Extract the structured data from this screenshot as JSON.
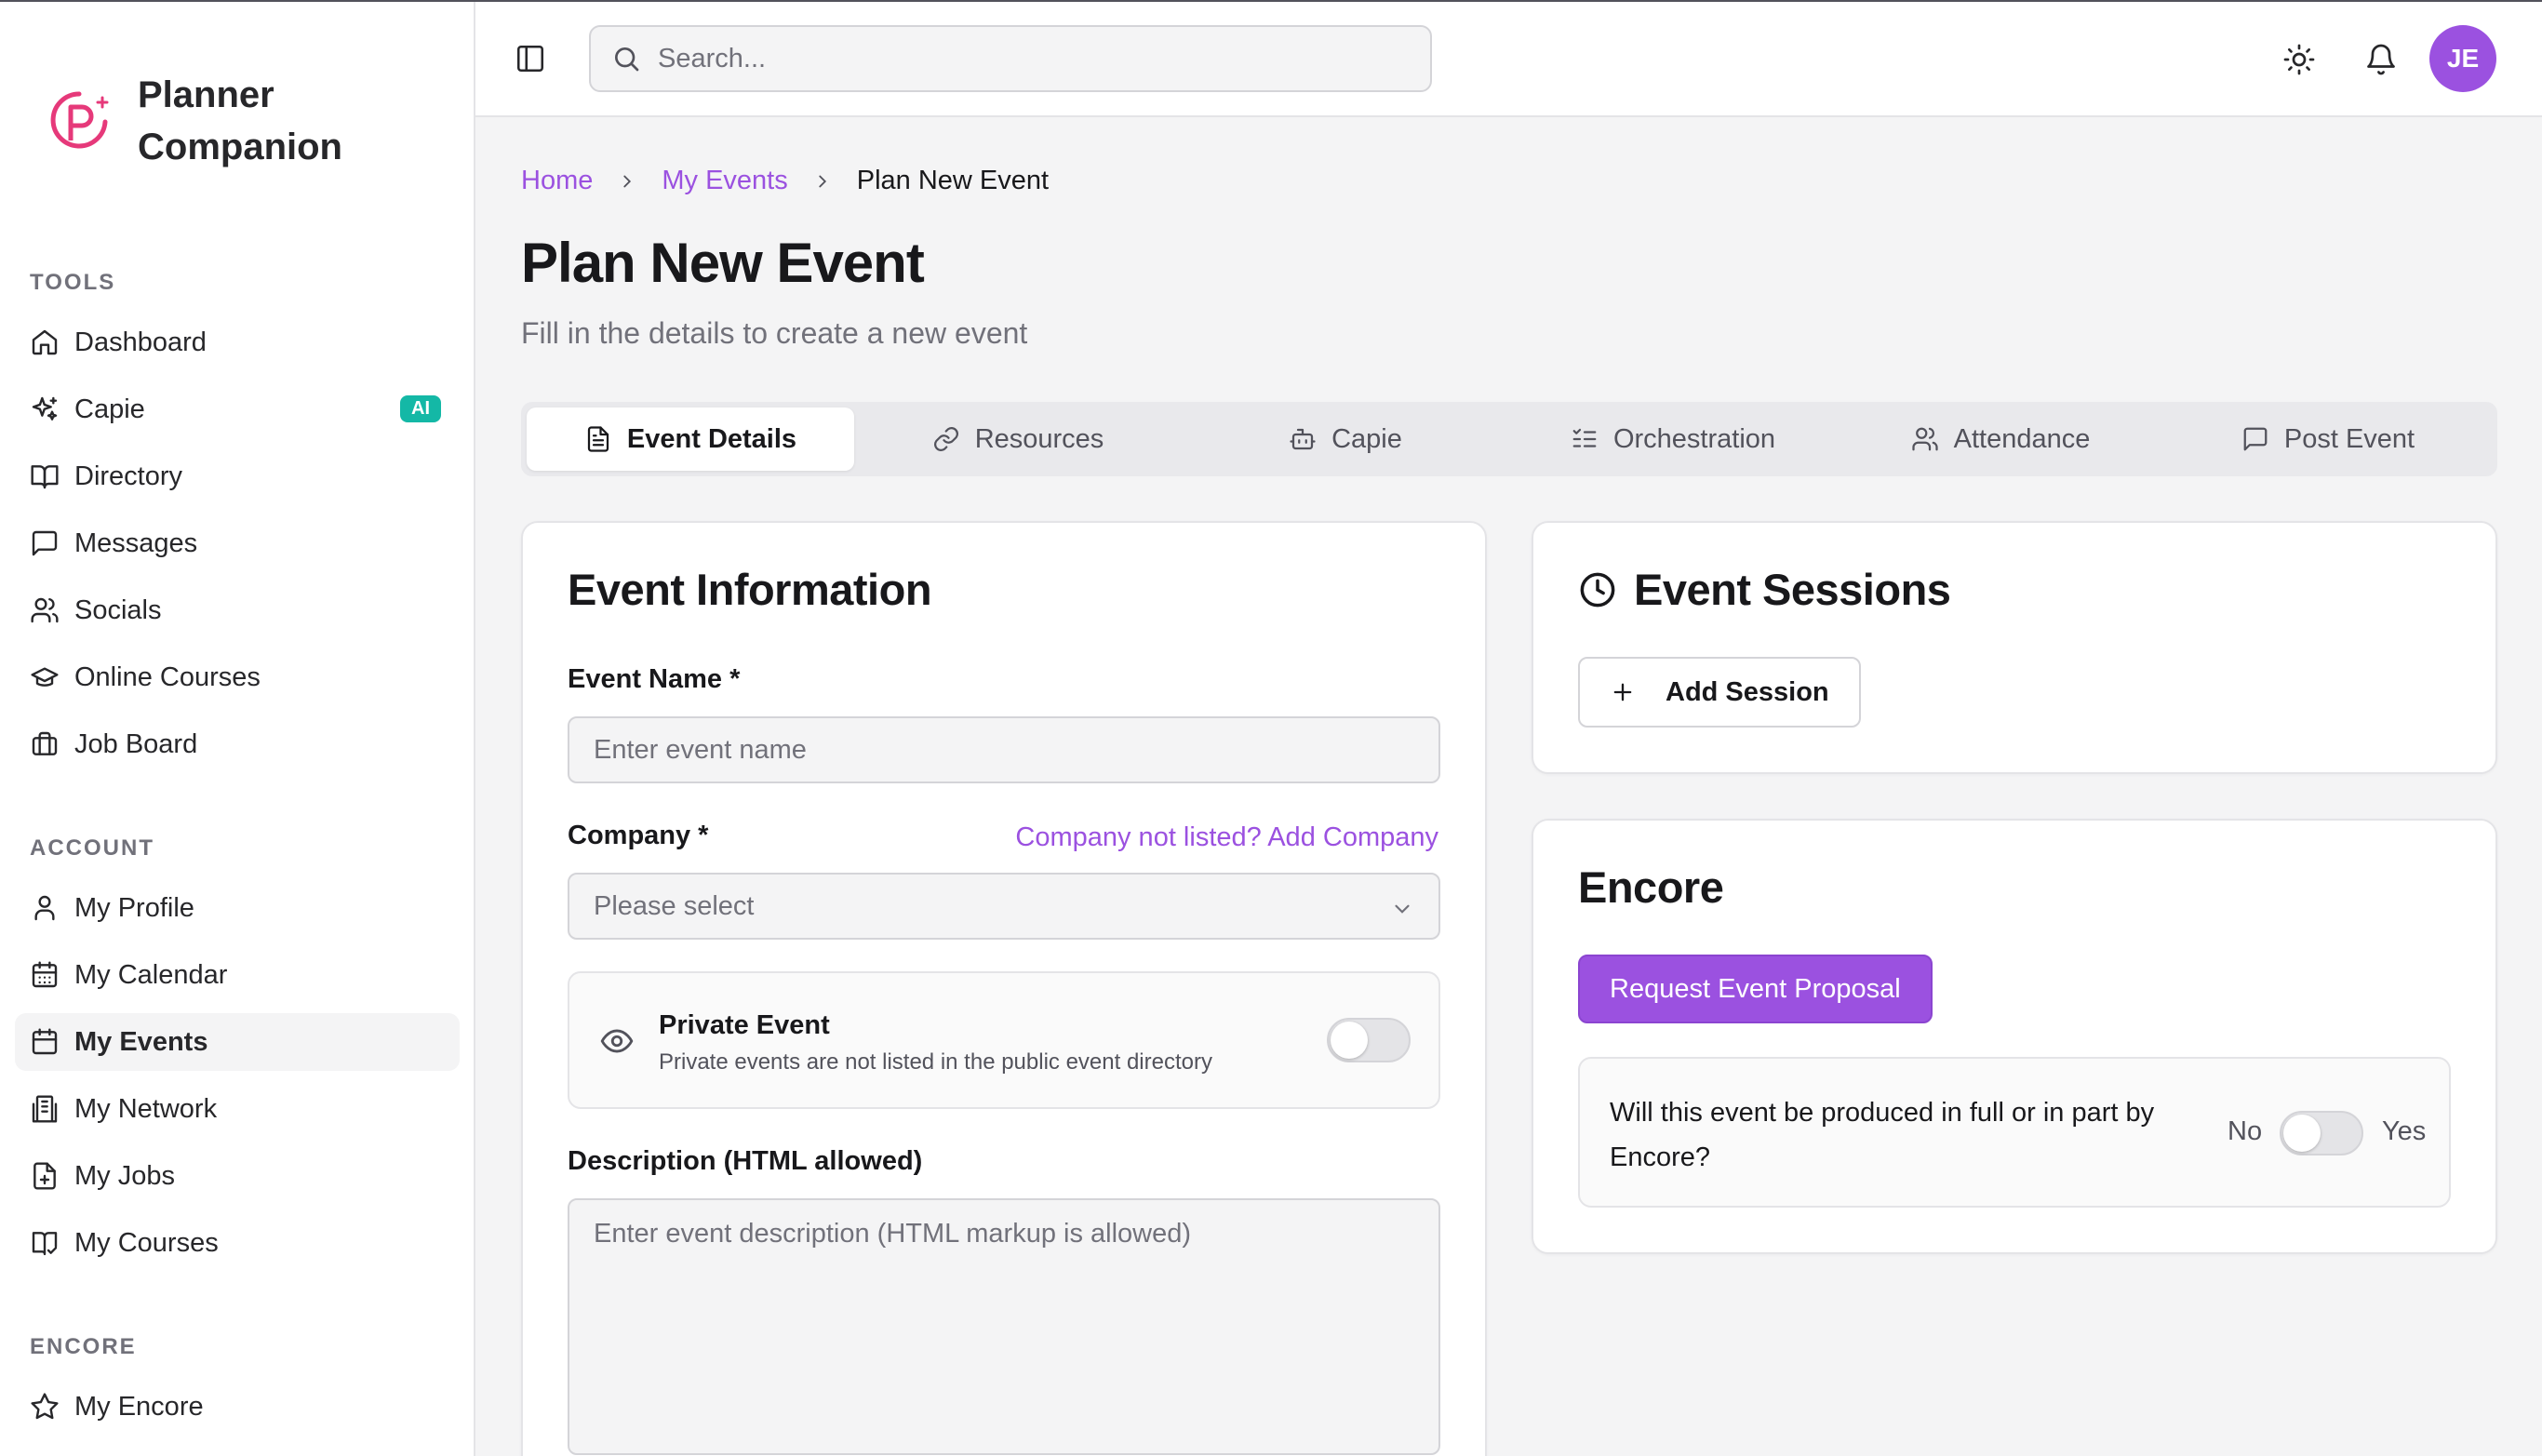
{
  "app": {
    "name": "Planner Companion",
    "brand_color": "#e6397a",
    "accent_color": "#9b51e0"
  },
  "sidebar": {
    "sections": {
      "tools": "TOOLS",
      "account": "ACCOUNT",
      "encore": "ENCORE"
    },
    "items": [
      {
        "label": "Dashboard",
        "icon": "home-icon"
      },
      {
        "label": "Capie",
        "icon": "sparkles-icon",
        "badge": "AI"
      },
      {
        "label": "Directory",
        "icon": "book-open-icon"
      },
      {
        "label": "Messages",
        "icon": "message-square-icon"
      },
      {
        "label": "Socials",
        "icon": "users-icon"
      },
      {
        "label": "Online Courses",
        "icon": "graduation-cap-icon"
      },
      {
        "label": "Job Board",
        "icon": "briefcase-icon"
      },
      {
        "label": "My Profile",
        "icon": "user-icon"
      },
      {
        "label": "My Calendar",
        "icon": "calendar-days-icon"
      },
      {
        "label": "My Events",
        "icon": "calendar-icon",
        "active": true
      },
      {
        "label": "My Network",
        "icon": "network-icon"
      },
      {
        "label": "My Jobs",
        "icon": "file-plus-icon"
      },
      {
        "label": "My Courses",
        "icon": "book-check-icon"
      },
      {
        "label": "My Encore",
        "icon": "star-icon"
      }
    ]
  },
  "header": {
    "search_placeholder": "Search...",
    "avatar_initials": "JE"
  },
  "breadcrumb": {
    "home": "Home",
    "parent": "My Events",
    "current": "Plan New Event"
  },
  "page": {
    "title": "Plan New Event",
    "subtitle": "Fill in the details to create a new event"
  },
  "tabs": [
    {
      "label": "Event Details",
      "icon": "file-text-icon",
      "active": true
    },
    {
      "label": "Resources",
      "icon": "link-icon"
    },
    {
      "label": "Capie",
      "icon": "bot-icon"
    },
    {
      "label": "Orchestration",
      "icon": "list-checks-icon"
    },
    {
      "label": "Attendance",
      "icon": "users-icon"
    },
    {
      "label": "Post Event",
      "icon": "message-square-icon"
    }
  ],
  "event_info": {
    "title": "Event Information",
    "name_label": "Event Name *",
    "name_placeholder": "Enter event name",
    "company_label": "Company *",
    "company_link": "Company not listed? Add Company",
    "company_select": "Please select",
    "private_title": "Private Event",
    "private_desc": "Private events are not listed in the public event directory",
    "private_enabled": false,
    "description_label": "Description (HTML allowed)",
    "description_placeholder": "Enter event description (HTML markup is allowed)"
  },
  "sessions": {
    "title": "Event Sessions",
    "add_button": "Add Session"
  },
  "encore": {
    "title": "Encore",
    "request_button": "Request Event Proposal",
    "question": "Will this event be produced in full or in part by Encore?",
    "no_label": "No",
    "yes_label": "Yes",
    "enabled": false
  }
}
